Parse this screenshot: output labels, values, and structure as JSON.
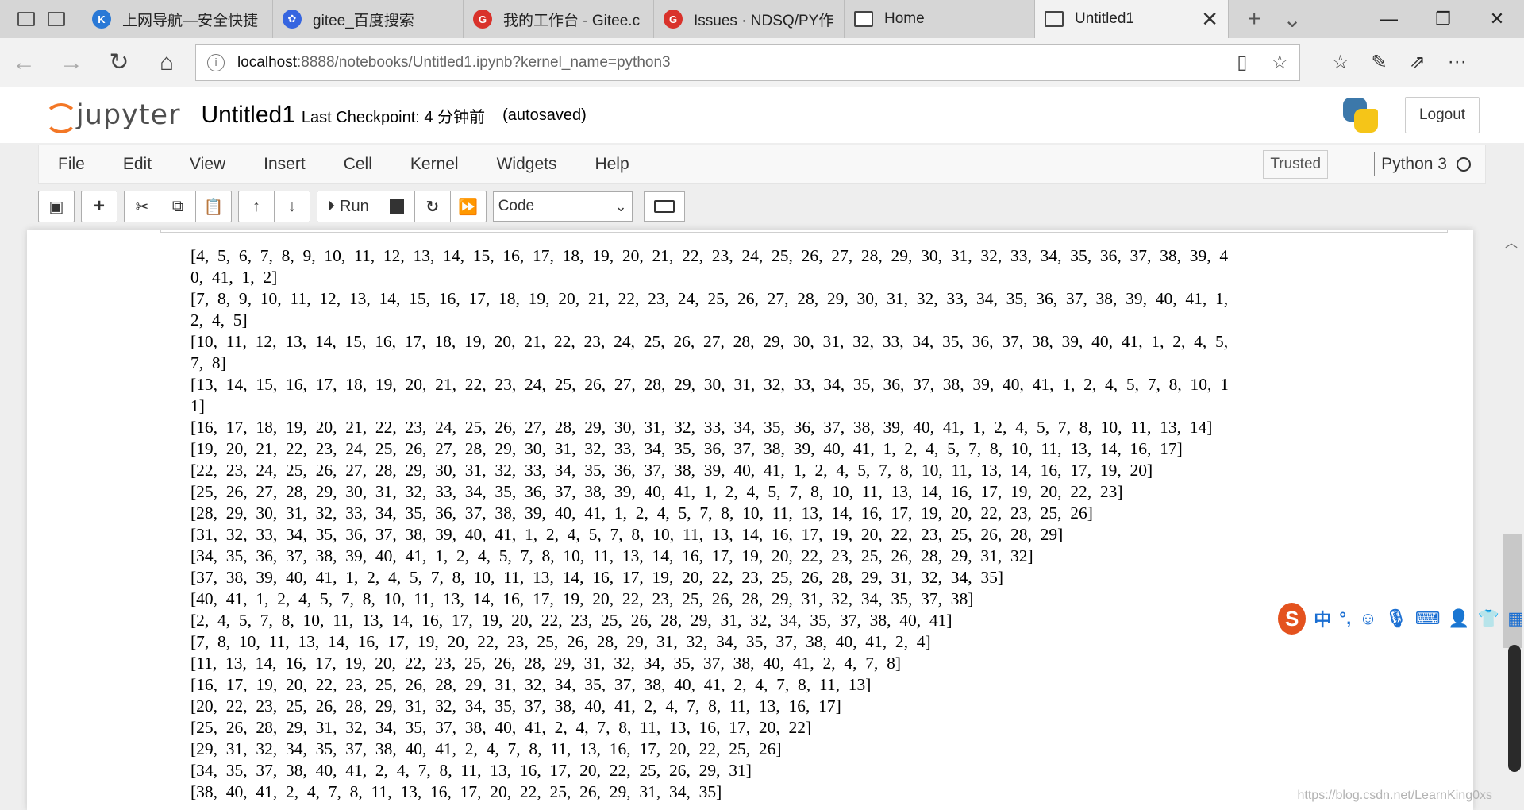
{
  "browser": {
    "tabs": [
      {
        "label": "上网导航—安全快捷",
        "fav_color": "#2a79d6",
        "fav_char": "K"
      },
      {
        "label": "gitee_百度搜索",
        "fav_color": "#3665e0",
        "fav_char": "✿"
      },
      {
        "label": "我的工作台 - Gitee.c",
        "fav_color": "#d9322b",
        "fav_char": "G"
      },
      {
        "label": "Issues · NDSQ/PY作业",
        "fav_color": "#d9322b",
        "fav_char": "G"
      },
      {
        "label": "Home",
        "fav_color": "#ffffff",
        "fav_char": ""
      }
    ],
    "active_tab": {
      "label": "Untitled1"
    },
    "url_host": "localhost",
    "url_rest": ":8888/notebooks/Untitled1.ipynb?kernel_name=python3"
  },
  "jupyter": {
    "logo_text": "jupyter",
    "notebook_name": "Untitled1",
    "checkpoint": "Last Checkpoint: 4 分钟前",
    "autosaved": "(autosaved)",
    "logout": "Logout",
    "menus": [
      "File",
      "Edit",
      "View",
      "Insert",
      "Cell",
      "Kernel",
      "Widgets",
      "Help"
    ],
    "trusted": "Trusted",
    "kernel": "Python 3",
    "run_label": "Run",
    "cell_type": "Code"
  },
  "output_lines": [
    "[4,  5,  6,  7,  8,  9,  10,  11,  12,  13,  14,  15,  16,  17,  18,  19,  20,  21,  22,  23,  24,  25,  26,  27,  28,  29,  30,  31,  32,  33,  34,  35,  36,  37,  38,  39,  4",
    "0,  41,  1,  2]",
    "[7,  8,  9,  10,  11,  12,  13,  14,  15,  16,  17,  18,  19,  20,  21,  22,  23,  24,  25,  26,  27,  28,  29,  30,  31,  32,  33,  34,  35,  36,  37,  38,  39,  40,  41,  1,",
    "2,  4,  5]",
    "[10,  11,  12,  13,  14,  15,  16,  17,  18,  19,  20,  21,  22,  23,  24,  25,  26,  27,  28,  29,  30,  31,  32,  33,  34,  35,  36,  37,  38,  39,  40,  41,  1,  2,  4,  5,",
    "7,  8]",
    "[13,  14,  15,  16,  17,  18,  19,  20,  21,  22,  23,  24,  25,  26,  27,  28,  29,  30,  31,  32,  33,  34,  35,  36,  37,  38,  39,  40,  41,  1,  2,  4,  5,  7,  8,  10,  1",
    "1]",
    "[16,  17,  18,  19,  20,  21,  22,  23,  24,  25,  26,  27,  28,  29,  30,  31,  32,  33,  34,  35,  36,  37,  38,  39,  40,  41,  1,  2,  4,  5,  7,  8,  10,  11,  13,  14]",
    "[19,  20,  21,  22,  23,  24,  25,  26,  27,  28,  29,  30,  31,  32,  33,  34,  35,  36,  37,  38,  39,  40,  41,  1,  2,  4,  5,  7,  8,  10,  11,  13,  14,  16,  17]",
    "[22,  23,  24,  25,  26,  27,  28,  29,  30,  31,  32,  33,  34,  35,  36,  37,  38,  39,  40,  41,  1,  2,  4,  5,  7,  8,  10,  11,  13,  14,  16,  17,  19,  20]",
    "[25,  26,  27,  28,  29,  30,  31,  32,  33,  34,  35,  36,  37,  38,  39,  40,  41,  1,  2,  4,  5,  7,  8,  10,  11,  13,  14,  16,  17,  19,  20,  22,  23]",
    "[28,  29,  30,  31,  32,  33,  34,  35,  36,  37,  38,  39,  40,  41,  1,  2,  4,  5,  7,  8,  10,  11,  13,  14,  16,  17,  19,  20,  22,  23,  25,  26]",
    "[31,  32,  33,  34,  35,  36,  37,  38,  39,  40,  41,  1,  2,  4,  5,  7,  8,  10,  11,  13,  14,  16,  17,  19,  20,  22,  23,  25,  26,  28,  29]",
    "[34,  35,  36,  37,  38,  39,  40,  41,  1,  2,  4,  5,  7,  8,  10,  11,  13,  14,  16,  17,  19,  20,  22,  23,  25,  26,  28,  29,  31,  32]",
    "[37,  38,  39,  40,  41,  1,  2,  4,  5,  7,  8,  10,  11,  13,  14,  16,  17,  19,  20,  22,  23,  25,  26,  28,  29,  31,  32,  34,  35]",
    "[40,  41,  1,  2,  4,  5,  7,  8,  10,  11,  13,  14,  16,  17,  19,  20,  22,  23,  25,  26,  28,  29,  31,  32,  34,  35,  37,  38]",
    "[2,  4,  5,  7,  8,  10,  11,  13,  14,  16,  17,  19,  20,  22,  23,  25,  26,  28,  29,  31,  32,  34,  35,  37,  38,  40,  41]",
    "[7,  8,  10,  11,  13,  14,  16,  17,  19,  20,  22,  23,  25,  26,  28,  29,  31,  32,  34,  35,  37,  38,  40,  41,  2,  4]",
    "[11,  13,  14,  16,  17,  19,  20,  22,  23,  25,  26,  28,  29,  31,  32,  34,  35,  37,  38,  40,  41,  2,  4,  7,  8]",
    "[16,  17,  19,  20,  22,  23,  25,  26,  28,  29,  31,  32,  34,  35,  37,  38,  40,  41,  2,  4,  7,  8,  11,  13]",
    "[20,  22,  23,  25,  26,  28,  29,  31,  32,  34,  35,  37,  38,  40,  41,  2,  4,  7,  8,  11,  13,  16,  17]",
    "[25,  26,  28,  29,  31,  32,  34,  35,  37,  38,  40,  41,  2,  4,  7,  8,  11,  13,  16,  17,  20,  22]",
    "[29,  31,  32,  34,  35,  37,  38,  40,  41,  2,  4,  7,  8,  11,  13,  16,  17,  20,  22,  25,  26]",
    "[34,  35,  37,  38,  40,  41,  2,  4,  7,  8,  11,  13,  16,  17,  20,  22,  25,  26,  29,  31]",
    "[38,  40,  41,  2,  4,  7,  8,  11,  13,  16,  17,  20,  22,  25,  26,  29,  31,  34,  35]"
  ],
  "ime": {
    "logo": "S",
    "mode": "中"
  },
  "watermark": "https://blog.csdn.net/LearnKing0xs"
}
